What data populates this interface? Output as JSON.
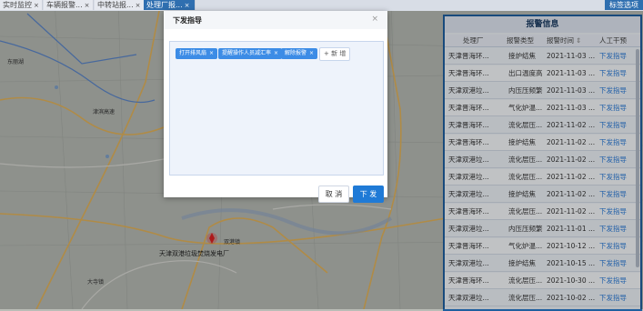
{
  "tabs": [
    {
      "label": "实时监控",
      "closable": true
    },
    {
      "label": "车辆报警...",
      "closable": true
    },
    {
      "label": "中转站报...",
      "closable": true
    },
    {
      "label": "处理厂报...",
      "closable": true,
      "active": true
    }
  ],
  "top_right_tab": "标签选项",
  "map": {
    "labels": [
      "东丽湖",
      "津滨高速",
      "双港镇",
      "大寺镇"
    ],
    "marker_label": "天津双港垃圾焚烧发电厂"
  },
  "modal": {
    "title": "下发指导",
    "close_label": "×",
    "chips": [
      "打开排风扇",
      "提醒操作人员减汇率",
      "解除报警"
    ],
    "chip_close": "×",
    "add_label": "+ 新 增",
    "cancel_label": "取 消",
    "submit_label": "下 发"
  },
  "panel": {
    "title": "报警信息",
    "columns": [
      "处理厂",
      "报警类型",
      "报警时间",
      "人工干预"
    ],
    "sort_icon": "sort-icon",
    "rows": [
      {
        "plant": "天津晋海环...",
        "type": "接炉结焦",
        "time": "2021-11-03 ...",
        "action": "下发指导"
      },
      {
        "plant": "天津晋海环...",
        "type": "出口温度高",
        "time": "2021-11-03 ...",
        "action": "下发指导"
      },
      {
        "plant": "天津双港垃...",
        "type": "内压压频繁",
        "time": "2021-11-03 ...",
        "action": "下发指导"
      },
      {
        "plant": "天津晋海环...",
        "type": "气化炉温...",
        "time": "2021-11-03 ...",
        "action": "下发指导"
      },
      {
        "plant": "天津晋海环...",
        "type": "流化层压...",
        "time": "2021-11-02 ...",
        "action": "下发指导"
      },
      {
        "plant": "天津晋海环...",
        "type": "接炉结焦",
        "time": "2021-11-02 ...",
        "action": "下发指导"
      },
      {
        "plant": "天津双港垃...",
        "type": "流化层压...",
        "time": "2021-11-02 ...",
        "action": "下发指导"
      },
      {
        "plant": "天津双港垃...",
        "type": "流化层压...",
        "time": "2021-11-02 ...",
        "action": "下发指导"
      },
      {
        "plant": "天津双港垃...",
        "type": "接炉结焦",
        "time": "2021-11-02 ...",
        "action": "下发指导"
      },
      {
        "plant": "天津晋海环...",
        "type": "流化层压...",
        "time": "2021-11-02 ...",
        "action": "下发指导"
      },
      {
        "plant": "天津双港垃...",
        "type": "内压压频繁",
        "time": "2021-11-01 ...",
        "action": "下发指导"
      },
      {
        "plant": "天津晋海环...",
        "type": "气化炉温...",
        "time": "2021-10-12 ...",
        "action": "下发指导"
      },
      {
        "plant": "天津双港垃...",
        "type": "接炉结焦",
        "time": "2021-10-15 ...",
        "action": "下发指导"
      },
      {
        "plant": "天津晋海环...",
        "type": "流化层压...",
        "time": "2021-10-30 ...",
        "action": "下发指导"
      },
      {
        "plant": "天津双港垃...",
        "type": "流化层压...",
        "time": "2021-10-02 ...",
        "action": "下发指导"
      }
    ]
  }
}
